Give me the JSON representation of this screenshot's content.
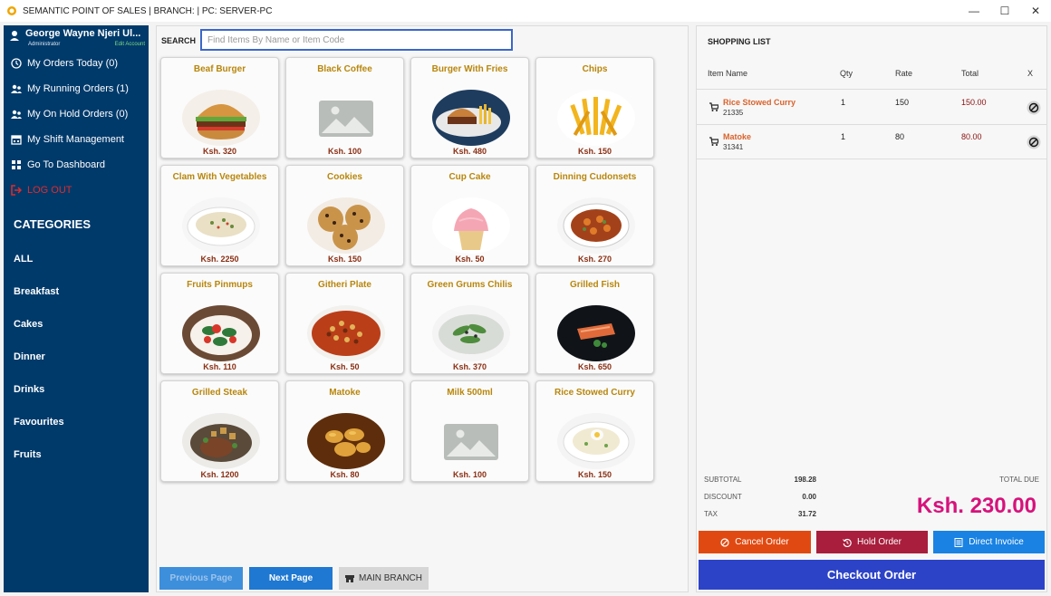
{
  "window": {
    "title": "SEMANTIC POINT OF SALES | BRANCH:  | PC: SERVER-PC",
    "minimize": "—",
    "maximize": "☐",
    "close": "✕"
  },
  "user": {
    "name": "George Wayne Njeri Ul...",
    "role": "Administrator",
    "edit_account": "Edit Account"
  },
  "menu": [
    {
      "label": "My Orders Today (0)",
      "icon": "clock-icon"
    },
    {
      "label": "My Running Orders (1)",
      "icon": "users-icon"
    },
    {
      "label": "My On Hold Orders (0)",
      "icon": "users-icon"
    },
    {
      "label": "My Shift Management",
      "icon": "calendar-icon"
    },
    {
      "label": "Go To Dashboard",
      "icon": "dashboard-icon"
    },
    {
      "label": "LOG OUT",
      "icon": "logout-icon"
    }
  ],
  "categories": {
    "title": "CATEGORIES",
    "items": [
      "ALL",
      "Breakfast",
      "Cakes",
      "Dinner",
      "Drinks",
      "Favourites",
      "Fruits"
    ]
  },
  "search": {
    "label": "SEARCH",
    "placeholder": "Find Items By Name or Item Code",
    "value": ""
  },
  "products": [
    {
      "name": "Beaf Burger",
      "price": "Ksh. 320",
      "image": "burger"
    },
    {
      "name": "Black Coffee",
      "price": "Ksh. 100",
      "image": "placeholder"
    },
    {
      "name": "Burger With Fries",
      "price": "Ksh. 480",
      "image": "burger-fries"
    },
    {
      "name": "Chips",
      "price": "Ksh. 150",
      "image": "chips"
    },
    {
      "name": "Clam With Vegetables",
      "price": "Ksh. 2250",
      "image": "soup"
    },
    {
      "name": "Cookies",
      "price": "Ksh. 150",
      "image": "cookies"
    },
    {
      "name": "Cup Cake",
      "price": "Ksh. 50",
      "image": "cupcake"
    },
    {
      "name": "Dinning Cudonsets",
      "price": "Ksh. 270",
      "image": "stew"
    },
    {
      "name": "Fruits Pinmups",
      "price": "Ksh. 110",
      "image": "salad"
    },
    {
      "name": "Githeri Plate",
      "price": "Ksh. 50",
      "image": "beans"
    },
    {
      "name": "Green Grums Chilis",
      "price": "Ksh. 370",
      "image": "greens"
    },
    {
      "name": "Grilled Fish",
      "price": "Ksh. 650",
      "image": "fish"
    },
    {
      "name": "Grilled Steak",
      "price": "Ksh. 1200",
      "image": "steak"
    },
    {
      "name": "Matoke",
      "price": "Ksh. 80",
      "image": "matoke"
    },
    {
      "name": "Milk 500ml",
      "price": "Ksh. 100",
      "image": "placeholder"
    },
    {
      "name": "Rice Stowed Curry",
      "price": "Ksh. 150",
      "image": "rice"
    }
  ],
  "pager": {
    "previous": "Previous Page",
    "next": "Next Page",
    "branch": "MAIN BRANCH"
  },
  "shopping": {
    "title": "SHOPPING LIST",
    "columns": {
      "name": "Item Name",
      "qty": "Qty",
      "rate": "Rate",
      "total": "Total",
      "remove": "X"
    },
    "items": [
      {
        "name": "Rice Stowed Curry",
        "code": "21335",
        "qty": "1",
        "rate": "150",
        "total": "150.00"
      },
      {
        "name": "Matoke",
        "code": "31341",
        "qty": "1",
        "rate": "80",
        "total": "80.00"
      }
    ]
  },
  "summary": {
    "subtotal_label": "SUBTOTAL",
    "subtotal": "198.28",
    "discount_label": "DISCOUNT",
    "discount": "0.00",
    "tax_label": "TAX",
    "tax": "31.72",
    "total_due_label": "TOTAL DUE",
    "total_due": "Ksh. 230.00"
  },
  "actions": {
    "cancel": "Cancel Order",
    "hold": "Hold Order",
    "invoice": "Direct Invoice",
    "checkout": "Checkout Order"
  },
  "colors": {
    "sidebar": "#003a6b",
    "product_name": "#b8860b",
    "price": "#8a2e12",
    "total_due": "#d6127c",
    "cancel": "#e04a12",
    "hold": "#a81e3c",
    "invoice": "#1a82e2",
    "checkout": "#2d43c7"
  }
}
